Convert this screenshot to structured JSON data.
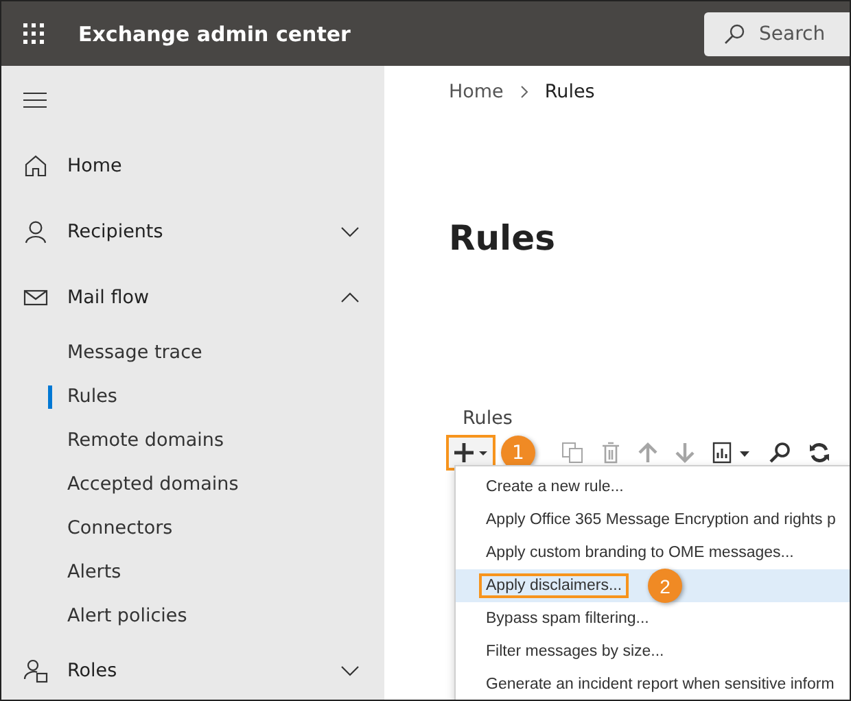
{
  "app": {
    "title": "Exchange admin center",
    "search": {
      "placeholder": "Search"
    }
  },
  "sidebar": {
    "items": [
      {
        "label": "Home",
        "kind": "link"
      },
      {
        "label": "Recipients",
        "kind": "group",
        "expanded": false
      },
      {
        "label": "Mail flow",
        "kind": "group",
        "expanded": true,
        "children": [
          {
            "label": "Message trace",
            "selected": false
          },
          {
            "label": "Rules",
            "selected": true
          },
          {
            "label": "Remote domains",
            "selected": false
          },
          {
            "label": "Accepted domains",
            "selected": false
          },
          {
            "label": "Connectors",
            "selected": false
          },
          {
            "label": "Alerts",
            "selected": false
          },
          {
            "label": "Alert policies",
            "selected": false
          }
        ]
      },
      {
        "label": "Roles",
        "kind": "group",
        "expanded": false
      }
    ]
  },
  "breadcrumb": [
    "Home",
    "Rules"
  ],
  "page_title": "Rules",
  "section_label": "Rules",
  "toolbar": [
    {
      "kind": "add",
      "disabled": false,
      "highlighted": true,
      "callout": "1"
    },
    {
      "kind": "copy",
      "disabled": true,
      "highlighted": false
    },
    {
      "kind": "delete",
      "disabled": true,
      "highlighted": false
    },
    {
      "kind": "up",
      "disabled": true,
      "highlighted": false
    },
    {
      "kind": "down",
      "disabled": true,
      "highlighted": false
    },
    {
      "kind": "report",
      "disabled": false,
      "highlighted": false
    },
    {
      "kind": "search",
      "disabled": false,
      "highlighted": false
    },
    {
      "kind": "refresh",
      "disabled": false,
      "highlighted": false
    }
  ],
  "menu": [
    {
      "label": "Create a new rule...",
      "selected": false,
      "highlighted": false
    },
    {
      "label": "Apply Office 365 Message Encryption and rights p",
      "selected": false,
      "highlighted": false
    },
    {
      "label": "Apply custom branding to OME messages...",
      "selected": false,
      "highlighted": false
    },
    {
      "label": "Apply disclaimers...",
      "selected": true,
      "highlighted": true,
      "callout": "2"
    },
    {
      "label": "Bypass spam filtering...",
      "selected": false,
      "highlighted": false
    },
    {
      "label": "Filter messages by size...",
      "selected": false,
      "highlighted": false
    },
    {
      "label": "Generate an incident report when sensitive inform",
      "selected": false,
      "highlighted": false
    }
  ]
}
